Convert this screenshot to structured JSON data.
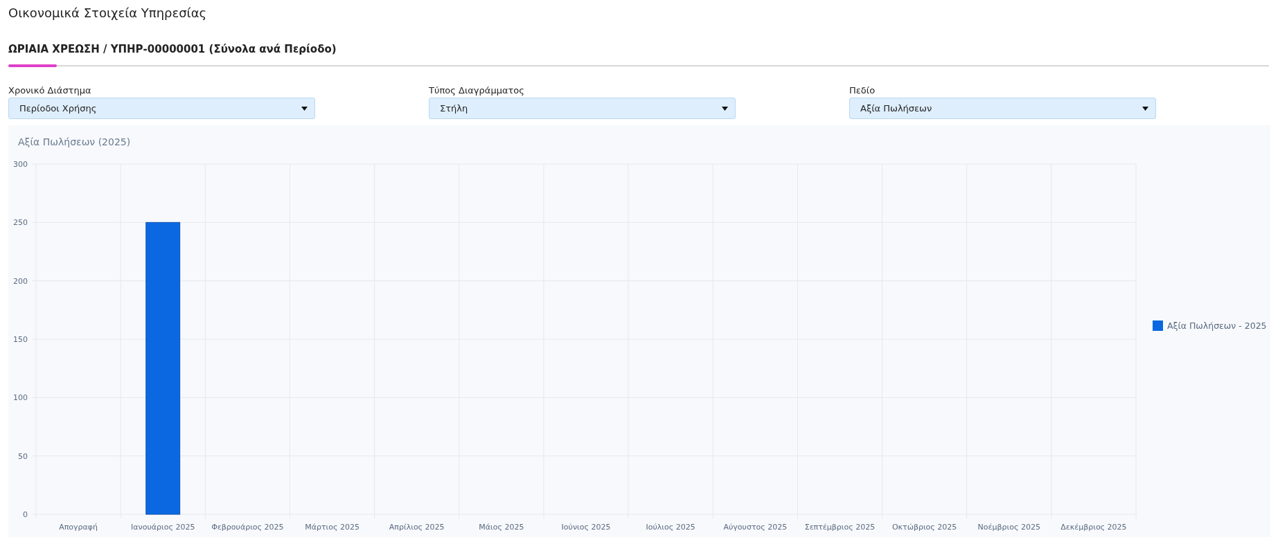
{
  "page": {
    "title": "Οικονομικά Στοιχεία Υπηρεσίας"
  },
  "tabs": [
    {
      "label": "ΩΡΙΑΙΑ ΧΡΕΩΣΗ / ΥΠΗΡ-00000001 (Σύνολα ανά Περίοδο)",
      "selected": true
    }
  ],
  "filters": [
    {
      "label": "Χρονικό Διάστημα",
      "value": "Περίοδοι Χρήσης"
    },
    {
      "label": "Τύπος Διαγράμματος",
      "value": "Στήλη"
    },
    {
      "label": "Πεδίο",
      "value": "Αξία Πωλήσεων"
    }
  ],
  "chart": {
    "chart_data": {
      "type": "bar",
      "title": "Αξία Πωλήσεων (2025)",
      "categories": [
        "Απογραφή",
        "Ιανουάριος 2025",
        "Φεβρουάριος 2025",
        "Μάρτιος 2025",
        "Απρίλιος 2025",
        "Μάιος 2025",
        "Ιούνιος 2025",
        "Ιούλιος 2025",
        "Αύγουστος 2025",
        "Σεπτέμβριος 2025",
        "Οκτώβριος 2025",
        "Νοέμβριος 2025",
        "Δεκέμβριος 2025"
      ],
      "series": [
        {
          "name": "Αξία Πωλήσεων - 2025",
          "color": "#0b68e1",
          "values": [
            0,
            250,
            0,
            0,
            0,
            0,
            0,
            0,
            0,
            0,
            0,
            0,
            0
          ]
        }
      ],
      "grid": true,
      "ylim": [
        0,
        300
      ],
      "yticks": [
        0,
        50,
        100,
        150,
        200,
        250,
        300
      ]
    }
  }
}
